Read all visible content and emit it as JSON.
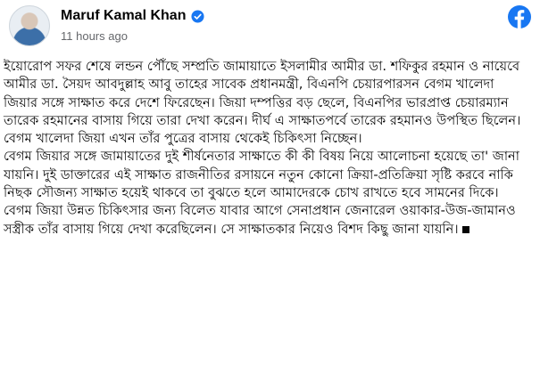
{
  "post": {
    "author": "Maruf Kamal Khan",
    "timestamp": "11 hours ago",
    "icons": {
      "verified": "verified-badge-icon",
      "brand": "facebook-logo-icon"
    },
    "colors": {
      "brand": "#1877F2",
      "timestamp": "#65676B"
    },
    "paragraphs": [
      "ইয়োরোপ সফর শেষে লন্ডন পৌঁছে সম্প্রতি জামায়াতে ইসলামীর আমীর ডা. শফিকুর রহমান ও নায়েবে আমীর ডা. সৈয়দ আবদুল্লাহ আবু তাহের সাবেক প্রধানমন্ত্রী, বিএনপি চেয়ারপারসন বেগম খালেদা জিয়ার সঙ্গে সাক্ষাত করে দেশে ফিরেছেন। জিয়া দম্পত্তির বড় ছেলে, বিএনপির ভারপ্রাপ্ত চেয়ারম্যান তারেক রহমানের বাসায় গিয়ে তারা দেখা করেন। দীর্ঘ এ সাক্ষাতপর্বে তারেক রহমানও উপস্থিত ছিলেন। বেগম খালেদা জিয়া এখন তাঁর পুত্রের বাসায় থেকেই চিকিৎসা নিচ্ছেন।",
      "বেগম জিয়ার সঙ্গে জামায়াতের দুই শীর্ষনেতার সাক্ষাতে কী কী বিষয় নিয়ে আলোচনা হয়েছে তা' জানা যায়নি। দুই ডাক্তারের এই সাক্ষাত রাজনীতির রসায়নে নতুন কোনো ক্রিয়া-প্রতিক্রিয়া সৃষ্টি করবে নাকি নিছক সৌজন্য সাক্ষাত হয়েই থাকবে তা বুঝতে হলে আমাদেরকে চোখ রাখতে হবে সামনের দিকে।",
      "বেগম জিয়া উন্নত চিকিৎসার জন্য বিলেত যাবার আগে সেনাপ্রধান জেনারেল ওয়াকার-উজ-জামানও সস্ত্রীক তাঁর বাসায় গিয়ে দেখা করেছিলেন। সে সাক্ষাতকার নিয়েও বিশদ কিছু জানা যায়নি।"
    ]
  }
}
